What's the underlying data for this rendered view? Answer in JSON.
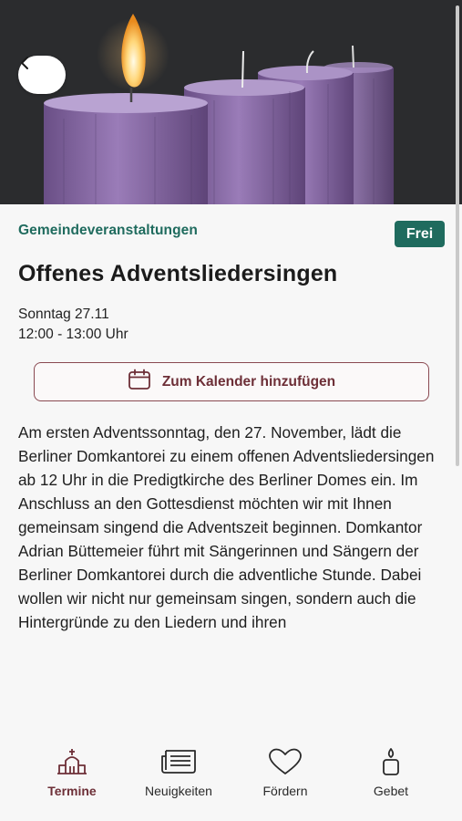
{
  "event": {
    "category": "Gemeindeveranstaltungen",
    "badge": "Frei",
    "title": "Offenes Adventsliedersingen",
    "date": "Sonntag 27.11",
    "time": "12:00 - 13:00 Uhr",
    "calendar_button": "Zum Kalender hinzufügen",
    "description": "Am ersten Adventssonntag, den 27. November, lädt die Berliner Domkantorei zu einem offenen Adventsliedersingen ab 12 Uhr in die Predigtkirche des Berliner Domes ein. Im Anschluss an den Gottesdienst möchten wir mit Ihnen gemeinsam singend die Adventszeit beginnen. Domkantor Adrian Büttemeier führt mit Sängerinnen und Sängern der Berliner Domkantorei durch die adventliche Stunde. Dabei wollen wir nicht nur gemeinsam singen, sondern auch die Hintergründe zu den Liedern und ihren"
  },
  "nav": {
    "items": [
      {
        "label": "Termine",
        "icon": "church-icon",
        "active": true
      },
      {
        "label": "Neuigkeiten",
        "icon": "newspaper-icon",
        "active": false
      },
      {
        "label": "Fördern",
        "icon": "heart-icon",
        "active": false
      },
      {
        "label": "Gebet",
        "icon": "candle-icon",
        "active": false
      }
    ]
  },
  "colors": {
    "accent_green": "#1f6b5e",
    "accent_wine": "#6d2f37",
    "candle_purple": "#8a6aa8"
  }
}
